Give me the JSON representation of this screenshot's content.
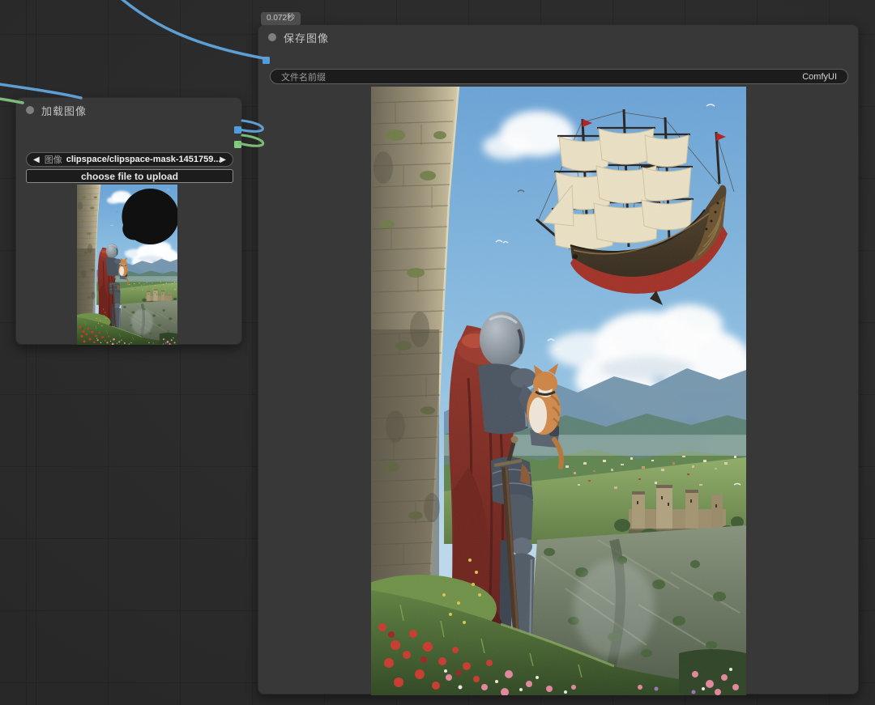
{
  "canvas": {
    "background_color": "#2b2b2b",
    "grid_color": "#252525"
  },
  "badge": {
    "execution_time": "0.072秒"
  },
  "save_node": {
    "title": "保存图像",
    "filename_widget": {
      "label": "文件名前缀",
      "value": "ComfyUI"
    },
    "input_port": {
      "type": "image",
      "color": "#4e9de0"
    },
    "preview_description": "Knight in steel armor with red hooded cape holding an orange cat, leaning on a stone tower above a valley town, watching a flying galleon with cream sails and red hull in a blue cloudy sky, wildflowers in the foreground"
  },
  "load_node": {
    "title": "加载图像",
    "image_widget": {
      "prev_arrow": "◀",
      "label": "图像",
      "value": "clipspace/clipspace-mask-1451759...",
      "next_arrow": "▶"
    },
    "upload_button_label": "choose file to upload",
    "output_ports": [
      {
        "type": "image",
        "color": "#4e9de0"
      },
      {
        "type": "mask",
        "color": "#7fcf7f"
      }
    ],
    "preview_description": "Same knight-and-cat image without the ship, with a black inpainting mask circle painted over the upper right sky"
  },
  "wire_colors": {
    "image_link": "#5d9fd3",
    "mask_link": "#7dbb7a"
  }
}
